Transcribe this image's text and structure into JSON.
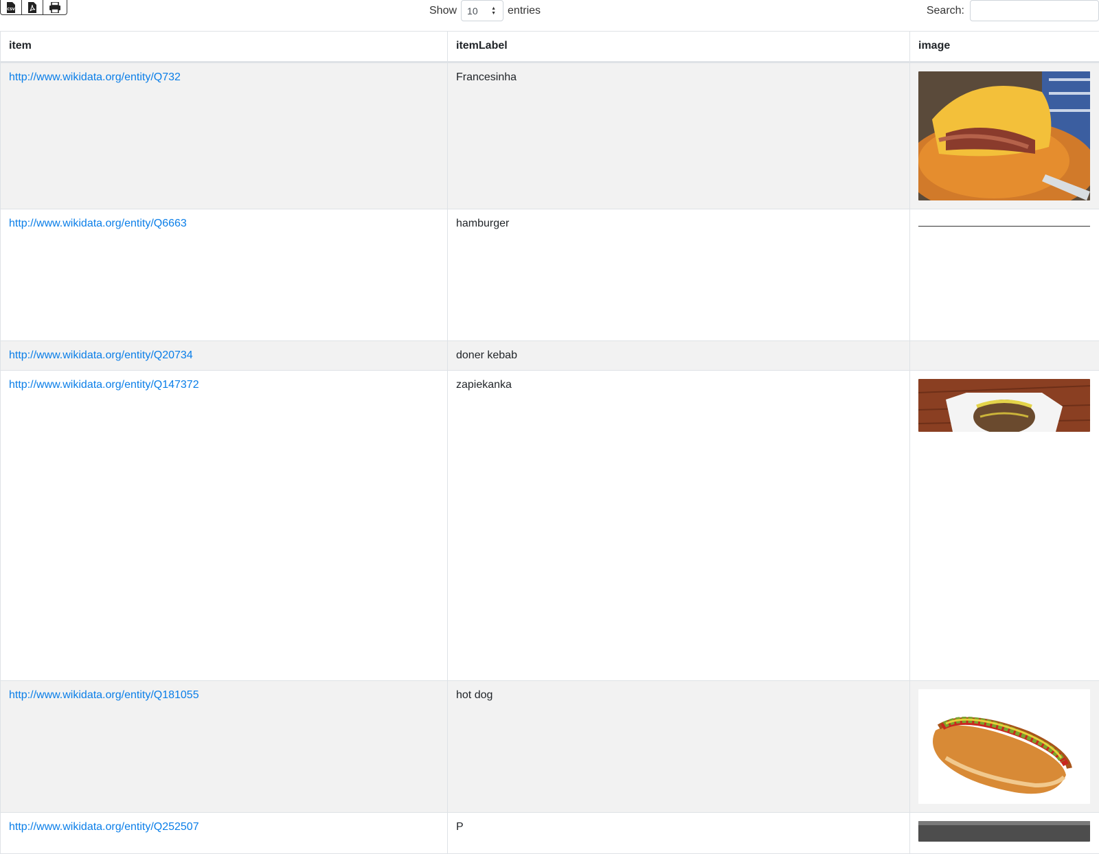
{
  "toolbar": {
    "export_buttons": [
      {
        "name": "csv-export-icon"
      },
      {
        "name": "pdf-export-icon"
      },
      {
        "name": "print-icon"
      }
    ],
    "show_label": "Show",
    "length_value": "10",
    "entries_label": "entries",
    "search_label": "Search:",
    "search_value": ""
  },
  "table": {
    "columns": [
      "item",
      "itemLabel",
      "image"
    ],
    "rows": [
      {
        "item": "http://www.wikidata.org/entity/Q732",
        "label": "Francesinha",
        "image": "francesinha-photo"
      },
      {
        "item": "http://www.wikidata.org/entity/Q6663",
        "label": "hamburger",
        "image": "broken-image"
      },
      {
        "item": "http://www.wikidata.org/entity/Q20734",
        "label": "doner kebab",
        "image": ""
      },
      {
        "item": "http://www.wikidata.org/entity/Q147372",
        "label": "zapiekanka",
        "image": "zapiekanka-photo"
      },
      {
        "item": "http://www.wikidata.org/entity/Q181055",
        "label": "hot dog",
        "image": "hot-dog-photo"
      },
      {
        "item": "http://www.wikidata.org/entity/Q252507",
        "label": "P",
        "image": "partial-photo"
      }
    ]
  },
  "colors": {
    "link": "#0a7ee8",
    "row_stripe": "#f2f2f2",
    "border": "#dee2e6"
  }
}
